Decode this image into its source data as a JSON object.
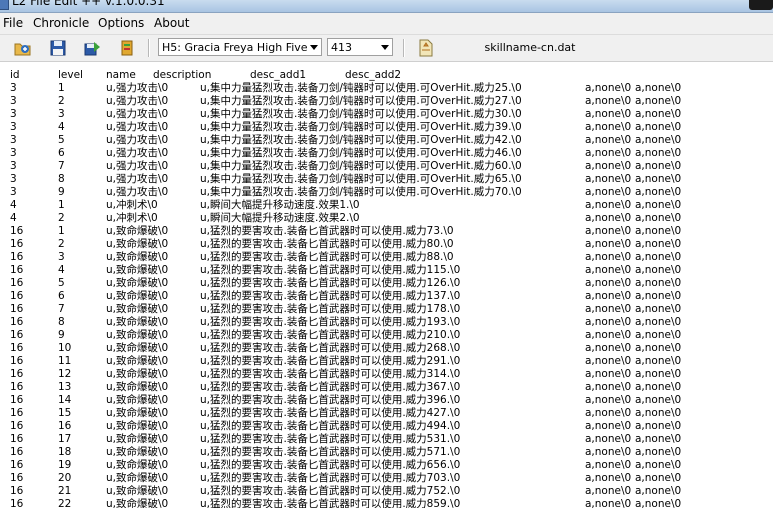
{
  "window": {
    "title": "L2 File Edit ++ v.1.0.0.31"
  },
  "menu": [
    "File",
    "Chronicle",
    "Options",
    "About"
  ],
  "toolbar": {
    "chronicle_select": "H5: Gracia Freya High Five",
    "version_select": "413",
    "file_name": "skillname-cn.dat"
  },
  "columns": [
    "id",
    "level",
    "name",
    "description",
    "desc_add1",
    "desc_add2"
  ],
  "rows": [
    {
      "id": "3",
      "level": "1",
      "name": "u,强力攻击\\0",
      "desc": "u,集中力量猛烈攻击.装备刀剑/钝器时可以使用.可OverHit.威力25.\\0",
      "add1": "a,none\\0",
      "add2": "a,none\\0"
    },
    {
      "id": "3",
      "level": "2",
      "name": "u,强力攻击\\0",
      "desc": "u,集中力量猛烈攻击.装备刀剑/钝器时可以使用.可OverHit.威力27.\\0",
      "add1": "a,none\\0",
      "add2": "a,none\\0"
    },
    {
      "id": "3",
      "level": "3",
      "name": "u,强力攻击\\0",
      "desc": "u,集中力量猛烈攻击.装备刀剑/钝器时可以使用.可OverHit.威力30.\\0",
      "add1": "a,none\\0",
      "add2": "a,none\\0"
    },
    {
      "id": "3",
      "level": "4",
      "name": "u,强力攻击\\0",
      "desc": "u,集中力量猛烈攻击.装备刀剑/钝器时可以使用.可OverHit.威力39.\\0",
      "add1": "a,none\\0",
      "add2": "a,none\\0"
    },
    {
      "id": "3",
      "level": "5",
      "name": "u,强力攻击\\0",
      "desc": "u,集中力量猛烈攻击.装备刀剑/钝器时可以使用.可OverHit.威力42.\\0",
      "add1": "a,none\\0",
      "add2": "a,none\\0"
    },
    {
      "id": "3",
      "level": "6",
      "name": "u,强力攻击\\0",
      "desc": "u,集中力量猛烈攻击.装备刀剑/钝器时可以使用.可OverHit.威力46.\\0",
      "add1": "a,none\\0",
      "add2": "a,none\\0"
    },
    {
      "id": "3",
      "level": "7",
      "name": "u,强力攻击\\0",
      "desc": "u,集中力量猛烈攻击.装备刀剑/钝器时可以使用.可OverHit.威力60.\\0",
      "add1": "a,none\\0",
      "add2": "a,none\\0"
    },
    {
      "id": "3",
      "level": "8",
      "name": "u,强力攻击\\0",
      "desc": "u,集中力量猛烈攻击.装备刀剑/钝器时可以使用.可OverHit.威力65.\\0",
      "add1": "a,none\\0",
      "add2": "a,none\\0"
    },
    {
      "id": "3",
      "level": "9",
      "name": "u,强力攻击\\0",
      "desc": "u,集中力量猛烈攻击.装备刀剑/钝器时可以使用.可OverHit.威力70.\\0",
      "add1": "a,none\\0",
      "add2": "a,none\\0"
    },
    {
      "id": "4",
      "level": "1",
      "name": "u,冲刺术\\0",
      "desc": "u,瞬间大幅提升移动速度.效果1.\\0",
      "add1": "a,none\\0",
      "add2": "a,none\\0"
    },
    {
      "id": "4",
      "level": "2",
      "name": "u,冲刺术\\0",
      "desc": "u,瞬间大幅提升移动速度.效果2.\\0",
      "add1": "a,none\\0",
      "add2": "a,none\\0"
    },
    {
      "id": "16",
      "level": "1",
      "name": "u,致命爆破\\0",
      "desc": "u,猛烈的要害攻击.装备匕首武器时可以使用.威力73.\\0",
      "add1": "a,none\\0",
      "add2": "a,none\\0"
    },
    {
      "id": "16",
      "level": "2",
      "name": "u,致命爆破\\0",
      "desc": "u,猛烈的要害攻击.装备匕首武器时可以使用.威力80.\\0",
      "add1": "a,none\\0",
      "add2": "a,none\\0"
    },
    {
      "id": "16",
      "level": "3",
      "name": "u,致命爆破\\0",
      "desc": "u,猛烈的要害攻击.装备匕首武器时可以使用.威力88.\\0",
      "add1": "a,none\\0",
      "add2": "a,none\\0"
    },
    {
      "id": "16",
      "level": "4",
      "name": "u,致命爆破\\0",
      "desc": "u,猛烈的要害攻击.装备匕首武器时可以使用.威力115.\\0",
      "add1": "a,none\\0",
      "add2": "a,none\\0"
    },
    {
      "id": "16",
      "level": "5",
      "name": "u,致命爆破\\0",
      "desc": "u,猛烈的要害攻击.装备匕首武器时可以使用.威力126.\\0",
      "add1": "a,none\\0",
      "add2": "a,none\\0"
    },
    {
      "id": "16",
      "level": "6",
      "name": "u,致命爆破\\0",
      "desc": "u,猛烈的要害攻击.装备匕首武器时可以使用.威力137.\\0",
      "add1": "a,none\\0",
      "add2": "a,none\\0"
    },
    {
      "id": "16",
      "level": "7",
      "name": "u,致命爆破\\0",
      "desc": "u,猛烈的要害攻击.装备匕首武器时可以使用.威力178.\\0",
      "add1": "a,none\\0",
      "add2": "a,none\\0"
    },
    {
      "id": "16",
      "level": "8",
      "name": "u,致命爆破\\0",
      "desc": "u,猛烈的要害攻击.装备匕首武器时可以使用.威力193.\\0",
      "add1": "a,none\\0",
      "add2": "a,none\\0"
    },
    {
      "id": "16",
      "level": "9",
      "name": "u,致命爆破\\0",
      "desc": "u,猛烈的要害攻击.装备匕首武器时可以使用.威力210.\\0",
      "add1": "a,none\\0",
      "add2": "a,none\\0"
    },
    {
      "id": "16",
      "level": "10",
      "name": "u,致命爆破\\0",
      "desc": "u,猛烈的要害攻击.装备匕首武器时可以使用.威力268.\\0",
      "add1": "a,none\\0",
      "add2": "a,none\\0"
    },
    {
      "id": "16",
      "level": "11",
      "name": "u,致命爆破\\0",
      "desc": "u,猛烈的要害攻击.装备匕首武器时可以使用.威力291.\\0",
      "add1": "a,none\\0",
      "add2": "a,none\\0"
    },
    {
      "id": "16",
      "level": "12",
      "name": "u,致命爆破\\0",
      "desc": "u,猛烈的要害攻击.装备匕首武器时可以使用.威力314.\\0",
      "add1": "a,none\\0",
      "add2": "a,none\\0"
    },
    {
      "id": "16",
      "level": "13",
      "name": "u,致命爆破\\0",
      "desc": "u,猛烈的要害攻击.装备匕首武器时可以使用.威力367.\\0",
      "add1": "a,none\\0",
      "add2": "a,none\\0"
    },
    {
      "id": "16",
      "level": "14",
      "name": "u,致命爆破\\0",
      "desc": "u,猛烈的要害攻击.装备匕首武器时可以使用.威力396.\\0",
      "add1": "a,none\\0",
      "add2": "a,none\\0"
    },
    {
      "id": "16",
      "level": "15",
      "name": "u,致命爆破\\0",
      "desc": "u,猛烈的要害攻击.装备匕首武器时可以使用.威力427.\\0",
      "add1": "a,none\\0",
      "add2": "a,none\\0"
    },
    {
      "id": "16",
      "level": "16",
      "name": "u,致命爆破\\0",
      "desc": "u,猛烈的要害攻击.装备匕首武器时可以使用.威力494.\\0",
      "add1": "a,none\\0",
      "add2": "a,none\\0"
    },
    {
      "id": "16",
      "level": "17",
      "name": "u,致命爆破\\0",
      "desc": "u,猛烈的要害攻击.装备匕首武器时可以使用.威力531.\\0",
      "add1": "a,none\\0",
      "add2": "a,none\\0"
    },
    {
      "id": "16",
      "level": "18",
      "name": "u,致命爆破\\0",
      "desc": "u,猛烈的要害攻击.装备匕首武器时可以使用.威力571.\\0",
      "add1": "a,none\\0",
      "add2": "a,none\\0"
    },
    {
      "id": "16",
      "level": "19",
      "name": "u,致命爆破\\0",
      "desc": "u,猛烈的要害攻击.装备匕首武器时可以使用.威力656.\\0",
      "add1": "a,none\\0",
      "add2": "a,none\\0"
    },
    {
      "id": "16",
      "level": "20",
      "name": "u,致命爆破\\0",
      "desc": "u,猛烈的要害攻击.装备匕首武器时可以使用.威力703.\\0",
      "add1": "a,none\\0",
      "add2": "a,none\\0"
    },
    {
      "id": "16",
      "level": "21",
      "name": "u,致命爆破\\0",
      "desc": "u,猛烈的要害攻击.装备匕首武器时可以使用.威力752.\\0",
      "add1": "a,none\\0",
      "add2": "a,none\\0"
    },
    {
      "id": "16",
      "level": "22",
      "name": "u,致命爆破\\0",
      "desc": "u,猛烈的要害攻击.装备匕首武器时可以使用.威力859.\\0",
      "add1": "a,none\\0",
      "add2": "a,none\\0"
    }
  ]
}
